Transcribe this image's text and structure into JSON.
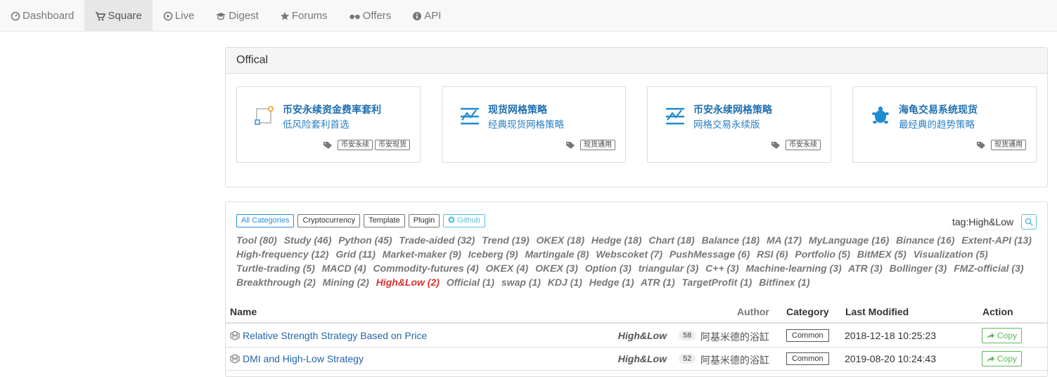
{
  "nav": {
    "items": [
      {
        "label": "Dashboard",
        "icon": "dashboard-icon"
      },
      {
        "label": "Square",
        "icon": "cart-icon",
        "active": true
      },
      {
        "label": "Live",
        "icon": "play-icon"
      },
      {
        "label": "Digest",
        "icon": "graduation-cap-icon"
      },
      {
        "label": "Forums",
        "icon": "star-icon"
      },
      {
        "label": "Offers",
        "icon": "glasses-icon"
      },
      {
        "label": "API",
        "icon": "info-icon"
      }
    ]
  },
  "official": {
    "title": "Offical",
    "cards": [
      {
        "title": "币安永续资金费率套利",
        "subtitle": "低风险套利首选",
        "tags": [
          "币安永续",
          "币安现货"
        ],
        "icon": "arbitrage-icon"
      },
      {
        "title": "现货网格策略",
        "subtitle": "经典现货网格策略",
        "tags": [
          "现货通用"
        ],
        "icon": "grid-chart-icon"
      },
      {
        "title": "币安永续网格策略",
        "subtitle": "网格交易永续版",
        "tags": [
          "币安永续"
        ],
        "icon": "grid-chart-icon"
      },
      {
        "title": "海龟交易系统现货",
        "subtitle": "最经典的趋势策略",
        "tags": [
          "现货通用"
        ],
        "icon": "turtle-icon"
      }
    ]
  },
  "filters": {
    "buttons": [
      "All Categories",
      "Cryptocurrency",
      "Template",
      "Plugin",
      "Github"
    ],
    "search_value": "tag:High&Low"
  },
  "tags": [
    "Tool (80)",
    "Study (46)",
    "Python (45)",
    "Trade-aided (32)",
    "Trend (19)",
    "OKEX (18)",
    "Hedge (18)",
    "Chart (18)",
    "Balance (18)",
    "MA (17)",
    "MyLanguage (16)",
    "Binance (16)",
    "Extent-API (13)",
    "High-frequency (12)",
    "Grid (11)",
    "Market-maker (9)",
    "Iceberg (9)",
    "Martingale (8)",
    "Webscoket (7)",
    "PushMessage (6)",
    "RSI (6)",
    "Portfolio (5)",
    "BitMEX (5)",
    "Visualization (5)",
    "Turtle-trading (5)",
    "MACD (4)",
    "Commodity-futures (4)",
    "OKEX (4)",
    "OKEX (3)",
    "Option (3)",
    "triangular (3)",
    "C++ (3)",
    "Machine-learning (3)",
    "ATR (3)",
    "Bollinger (3)",
    "FMZ-official (3)",
    "Breakthrough (2)",
    "Mining (2)",
    "High&Low (2)",
    "Official (1)",
    "swap (1)",
    "KDJ (1)",
    "Hedge (1)",
    "ATR (1)",
    "TargetProfit (1)",
    "Bitfinex (1)"
  ],
  "active_tag": "High&Low (2)",
  "table": {
    "headers": {
      "name": "Name",
      "author": "Author",
      "category": "Category",
      "modified": "Last Modified",
      "action": "Action"
    },
    "rows": [
      {
        "name": "Relative Strength Strategy Based on Price",
        "tag": "High&Low",
        "count": "58",
        "author": "阿基米德的浴缸",
        "category": "Common",
        "modified": "2018-12-18 10:25:23",
        "action": "Copy"
      },
      {
        "name": "DMI and High-Low Strategy",
        "tag": "High&Low",
        "count": "52",
        "author": "阿基米德的浴缸",
        "category": "Common",
        "modified": "2019-08-20 10:24:43",
        "action": "Copy"
      }
    ]
  }
}
